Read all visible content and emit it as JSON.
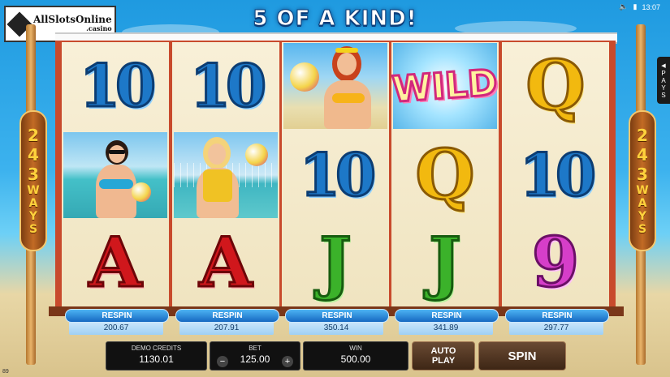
{
  "logo": {
    "text": "AllSlotsOnline",
    "sub": ".casino"
  },
  "banner": "5 OF A KIND!",
  "status": {
    "time": "13:07"
  },
  "side_badge": {
    "number": "243",
    "label": "WAYS"
  },
  "pays_tab": {
    "letters": [
      "P",
      "A",
      "Y",
      "S"
    ]
  },
  "reels": [
    {
      "symbols": [
        "10",
        "girl-sunglasses",
        "A"
      ],
      "respin_label": "RESPIN",
      "respin_cost": "200.67"
    },
    {
      "symbols": [
        "10",
        "girl-blonde",
        "A"
      ],
      "respin_label": "RESPIN",
      "respin_cost": "207.91"
    },
    {
      "symbols": [
        "girl-redhead",
        "10",
        "J"
      ],
      "respin_label": "RESPIN",
      "respin_cost": "350.14"
    },
    {
      "symbols": [
        "WILD",
        "Q",
        "J"
      ],
      "respin_label": "RESPIN",
      "respin_cost": "341.89"
    },
    {
      "symbols": [
        "Q",
        "10",
        "9"
      ],
      "respin_label": "RESPIN",
      "respin_cost": "297.77"
    }
  ],
  "controls": {
    "credits_label": "DEMO CREDITS",
    "credits_value": "1130.01",
    "bet_label": "BET",
    "bet_value": "125.00",
    "bet_minus": "−",
    "bet_plus": "+",
    "win_label": "WIN",
    "win_value": "500.00",
    "autoplay_label": "AUTO PLAY",
    "spin_label": "SPIN"
  },
  "version": "89",
  "colors": {
    "reel_bg": "#f4ead0",
    "frame": "#c84a2c",
    "respin": "#1f7ad4"
  }
}
